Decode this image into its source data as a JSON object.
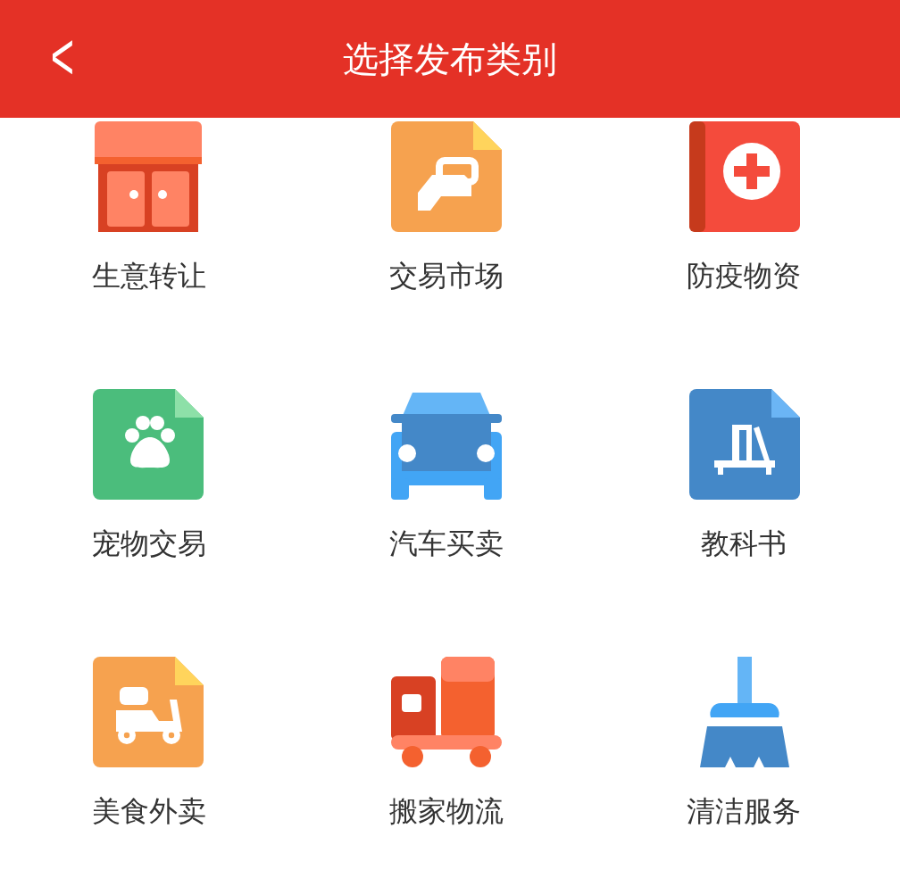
{
  "header": {
    "back": "<",
    "title": "选择发布类别"
  },
  "categories": [
    {
      "kind": "shop",
      "label": "生意转让"
    },
    {
      "kind": "trade",
      "label": "交易市场"
    },
    {
      "kind": "medical",
      "label": "防疫物资"
    },
    {
      "kind": "pet",
      "label": "宠物交易"
    },
    {
      "kind": "car",
      "label": "汽车买卖"
    },
    {
      "kind": "textbook",
      "label": "教科书"
    },
    {
      "kind": "delivery",
      "label": "美食外卖"
    },
    {
      "kind": "truck",
      "label": "搬家物流"
    },
    {
      "kind": "broom",
      "label": "清洁服务"
    }
  ]
}
